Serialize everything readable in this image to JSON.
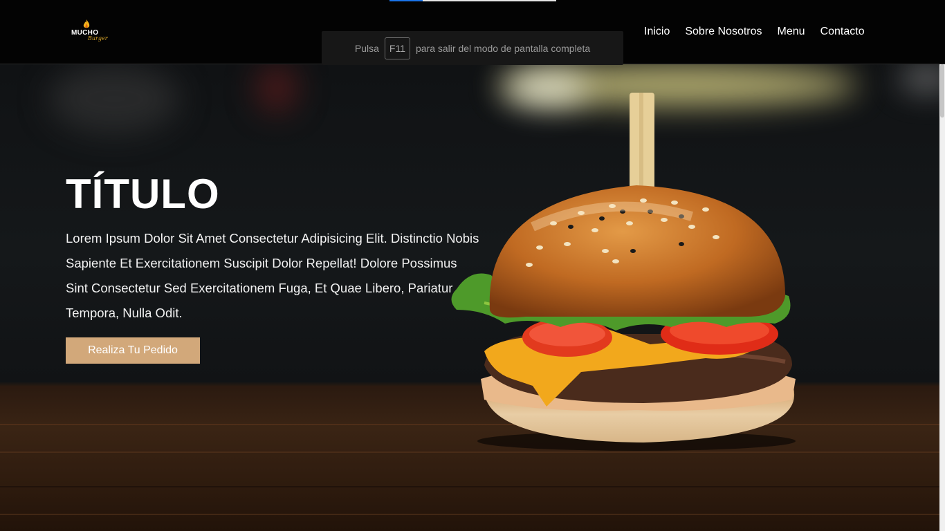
{
  "header": {
    "logo_text": "MUCHO",
    "logo_script": "Burger",
    "nav": [
      "Inicio",
      "Sobre Nosotros",
      "Menu",
      "Contacto"
    ]
  },
  "fullscreen_notice": {
    "before": "Pulsa",
    "key": "F11",
    "after": "para salir del modo de pantalla completa"
  },
  "hero": {
    "title": "TÍTULO",
    "description": "Lorem Ipsum Dolor Sit Amet Consectetur Adipisicing Elit. Distinctio Nobis Sapiente Et Exercitationem Suscipit Dolor Repellat! Dolore Possimus Sint Consectetur Sed Exercitationem Fuga, Et Quae Libero, Pariatur Tempora, Nulla Odit.",
    "cta_label": "Realiza Tu Pedido",
    "image": "burger-photo"
  },
  "colors": {
    "header_bg": "#030303",
    "cta_bg": "#d2a87a",
    "text": "#ffffff"
  }
}
